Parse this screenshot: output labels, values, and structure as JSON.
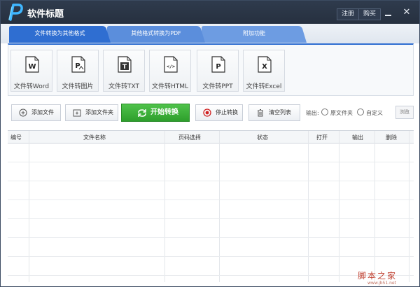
{
  "window": {
    "title": "软件标题",
    "register_label": "注册",
    "buy_label": "购买",
    "close_glyph": "✕"
  },
  "tabs": [
    {
      "label": "文件转换为其他格式",
      "active": true
    },
    {
      "label": "其他格式转换为PDF",
      "active": false
    },
    {
      "label": "附加功能",
      "active": false
    }
  ],
  "tools": [
    {
      "label": "文件转Word",
      "icon_letter": "W"
    },
    {
      "label": "文件转图片",
      "icon_letter": "P"
    },
    {
      "label": "文件转TXT",
      "icon_letter": "T"
    },
    {
      "label": "文件转HTML",
      "icon_letter": "</>"
    },
    {
      "label": "文件转PPT",
      "icon_letter": "P"
    },
    {
      "label": "文件转Excel",
      "icon_letter": "X"
    }
  ],
  "actions": {
    "add_file": "添加文件",
    "add_folder": "添加文件夹",
    "start": "开始转换",
    "stop": "停止转换",
    "clear": "清空列表"
  },
  "output": {
    "label": "输出:",
    "option_original": "原文件夹",
    "option_custom": "自定义",
    "browse": "浏览"
  },
  "table": {
    "columns": [
      "编号",
      "文件名称",
      "页码选择",
      "状态",
      "打开",
      "输出",
      "删除"
    ]
  },
  "watermark": {
    "text": "脚本之家",
    "sub": "www.jb51.net"
  },
  "colors": {
    "titlebar": "#2b3647",
    "tab_active": "#2f6ed1",
    "tab_inactive": "#5a8fdd",
    "start_button": "#3aae36",
    "accent_red": "#d02020"
  }
}
